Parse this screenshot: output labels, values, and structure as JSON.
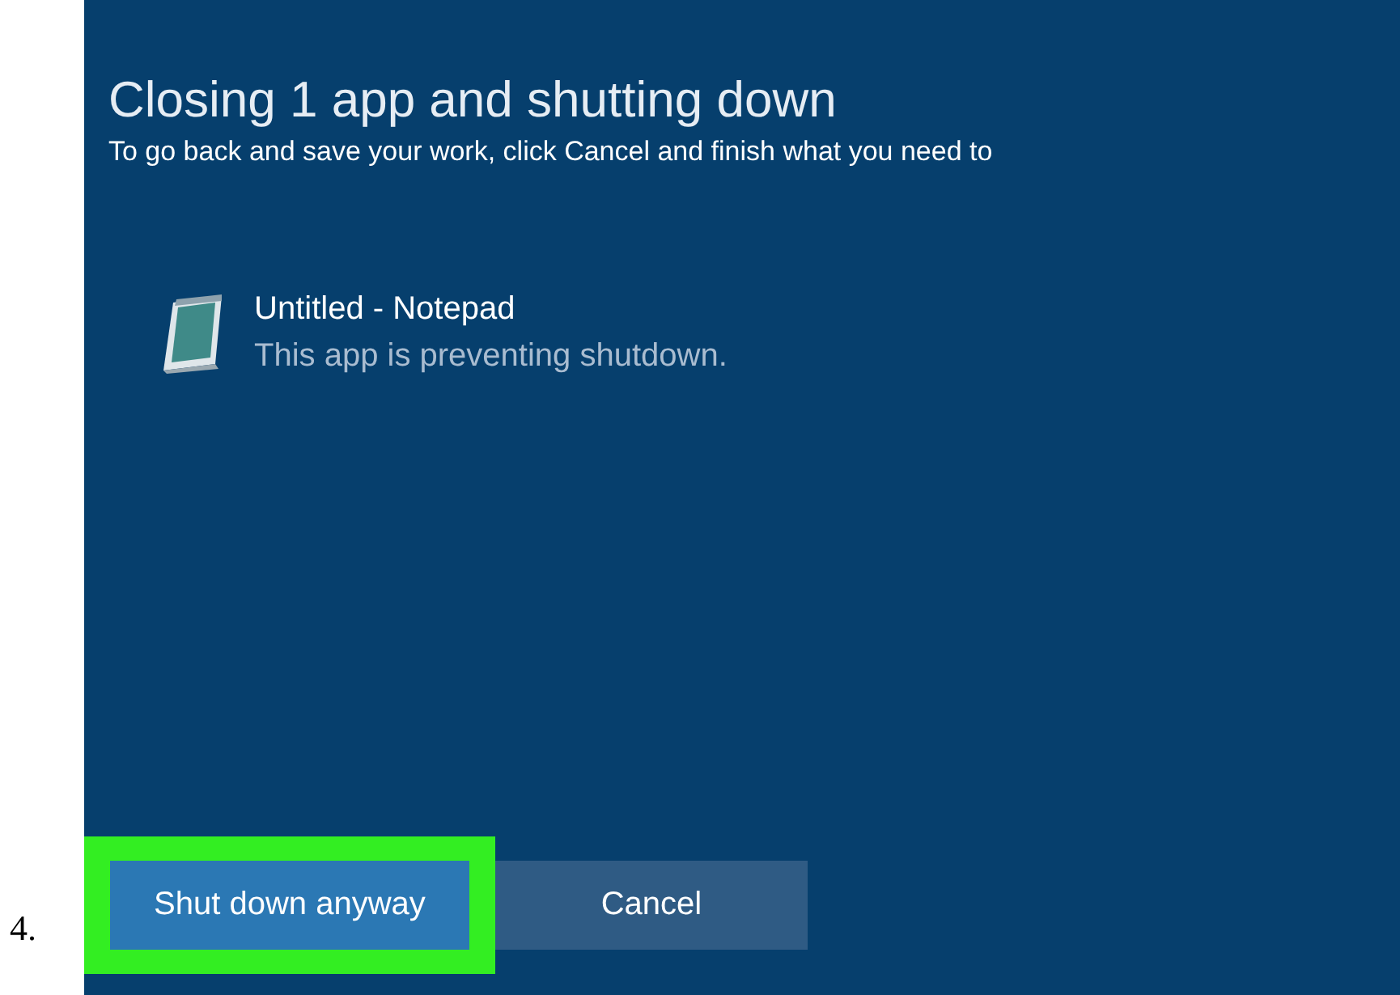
{
  "step_number": "4.",
  "dialog": {
    "title": "Closing 1 app and shutting down",
    "message": "To go back and save your work, click Cancel and finish what you need to",
    "apps": [
      {
        "name": "Untitled - Notepad",
        "status": "This app is preventing shutdown."
      }
    ],
    "buttons": [
      {
        "label": "Shut down anyway",
        "kind": "primary",
        "highlighted": true
      },
      {
        "label": "Cancel",
        "kind": "secondary",
        "highlighted": false
      }
    ]
  }
}
